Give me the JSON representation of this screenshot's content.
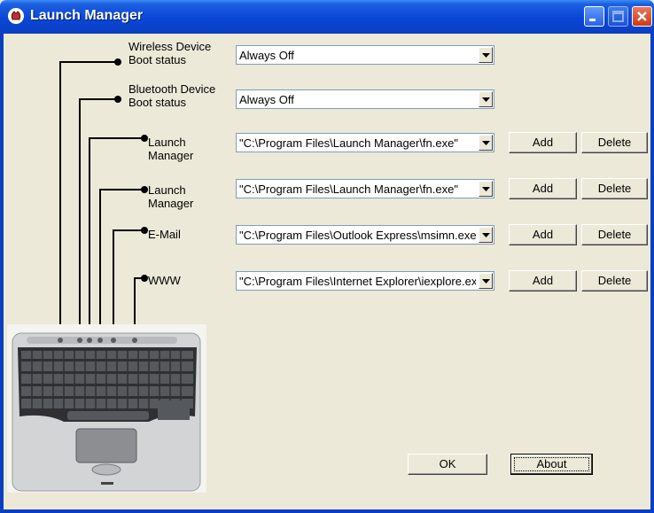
{
  "window": {
    "title": "Launch Manager",
    "title_icon": "launch-manager-app-icon"
  },
  "window_controls": {
    "minimize": "minimize-icon",
    "maximize": "maximize-icon",
    "close": "close-icon"
  },
  "rows": [
    {
      "label_line1": "Wireless Device",
      "label_line2": "Boot status",
      "value": "Always Off"
    },
    {
      "label_line1": "Bluetooth Device",
      "label_line2": "Boot status",
      "value": "Always Off"
    },
    {
      "label_line1": "Launch",
      "label_line2": "Manager",
      "value": "\"C:\\Program Files\\Launch Manager\\fn.exe\"",
      "add": "Add",
      "delete": "Delete"
    },
    {
      "label_line1": "Launch",
      "label_line2": "Manager",
      "value": "\"C:\\Program Files\\Launch Manager\\fn.exe\"",
      "add": "Add",
      "delete": "Delete"
    },
    {
      "label_line1": "E-Mail",
      "label_line2": "",
      "value": "\"C:\\Program Files\\Outlook Express\\msimn.exe\"",
      "add": "Add",
      "delete": "Delete"
    },
    {
      "label_line1": "WWW",
      "label_line2": "",
      "value": "\"C:\\Program Files\\Internet Explorer\\iexplore.exe\"",
      "add": "Add",
      "delete": "Delete"
    }
  ],
  "footer": {
    "ok": "OK",
    "about": "About"
  },
  "colors": {
    "titlebar": "#0a46d6",
    "dialog_bg": "#ece9d8",
    "close_button": "#c83b17"
  }
}
